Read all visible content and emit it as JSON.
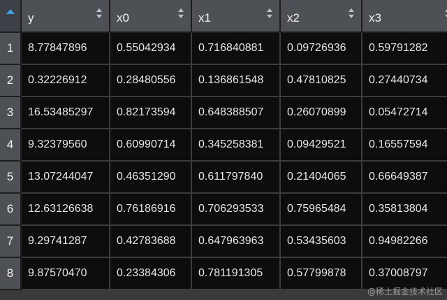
{
  "columns": [
    "y",
    "x0",
    "x1",
    "x2",
    "x3"
  ],
  "rows": [
    {
      "index": "1",
      "cells": [
        "8.77847896",
        "0.55042934",
        "0.716840881",
        "0.09726936",
        "0.59791282"
      ]
    },
    {
      "index": "2",
      "cells": [
        "0.32226912",
        "0.28480556",
        "0.136861548",
        "0.47810825",
        "0.27440734"
      ]
    },
    {
      "index": "3",
      "cells": [
        "16.53485297",
        "0.82173594",
        "0.648388507",
        "0.26070899",
        "0.05472714"
      ]
    },
    {
      "index": "4",
      "cells": [
        "9.32379560",
        "0.60990714",
        "0.345258381",
        "0.09429521",
        "0.16557594"
      ]
    },
    {
      "index": "5",
      "cells": [
        "13.07244047",
        "0.46351290",
        "0.611797840",
        "0.21404065",
        "0.66649387"
      ]
    },
    {
      "index": "6",
      "cells": [
        "12.63126638",
        "0.76186916",
        "0.706293533",
        "0.75965484",
        "0.35813804"
      ]
    },
    {
      "index": "7",
      "cells": [
        "9.29741287",
        "0.42783688",
        "0.647963963",
        "0.53435603",
        "0.94982266"
      ]
    },
    {
      "index": "8",
      "cells": [
        "9.87570470",
        "0.23384306",
        "0.781191305",
        "0.57799878",
        "0.37008797"
      ]
    }
  ],
  "watermark": "@稀土掘金技术社区",
  "colors": {
    "header_bg": "#4d5156",
    "cell_bg": "#0d0d0d",
    "sort_active": "#3fa0e0"
  },
  "icons": {
    "sort": "sort-arrows-icon",
    "sort_active": "sort-ascending-icon"
  }
}
